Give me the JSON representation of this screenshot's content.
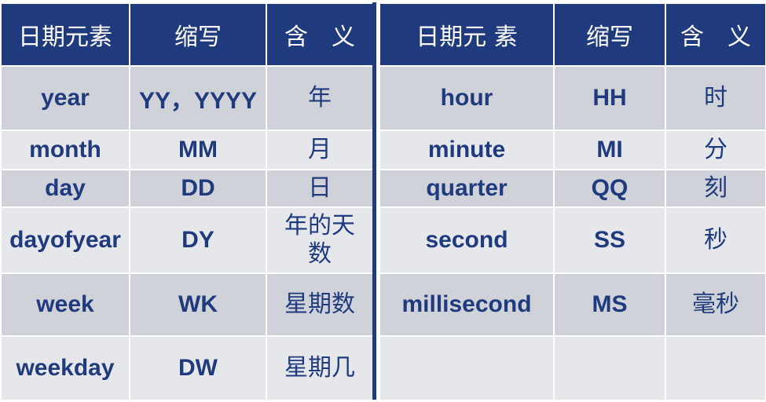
{
  "headers": {
    "left": [
      "日期元素",
      "缩写",
      "含　义"
    ],
    "right": [
      "日期元 素",
      "缩写",
      "含　义"
    ]
  },
  "left_rows": [
    {
      "element": "year",
      "abbr": "YY，YYYY",
      "meaning": "年"
    },
    {
      "element": "month",
      "abbr": "MM",
      "meaning": "月"
    },
    {
      "element": "day",
      "abbr": "DD",
      "meaning": "日"
    },
    {
      "element": "dayofyear",
      "abbr": "DY",
      "meaning": "年的天数"
    },
    {
      "element": "week",
      "abbr": "WK",
      "meaning": "星期数"
    },
    {
      "element": "weekday",
      "abbr": "DW",
      "meaning": "星期几"
    }
  ],
  "right_rows": [
    {
      "element": "hour",
      "abbr": "HH",
      "meaning": "时"
    },
    {
      "element": "minute",
      "abbr": "MI",
      "meaning": "分"
    },
    {
      "element": "quarter",
      "abbr": "QQ",
      "meaning": "刻"
    },
    {
      "element": "second",
      "abbr": "SS",
      "meaning": "秒"
    },
    {
      "element": "millisecond",
      "abbr": "MS",
      "meaning": "毫秒"
    },
    {
      "element": "",
      "abbr": "",
      "meaning": ""
    }
  ],
  "colors": {
    "header_bg": "#1f3a7d",
    "text": "#1f3a7d",
    "row_dark": "#d0d2d9",
    "row_light": "#e6e7eb"
  }
}
